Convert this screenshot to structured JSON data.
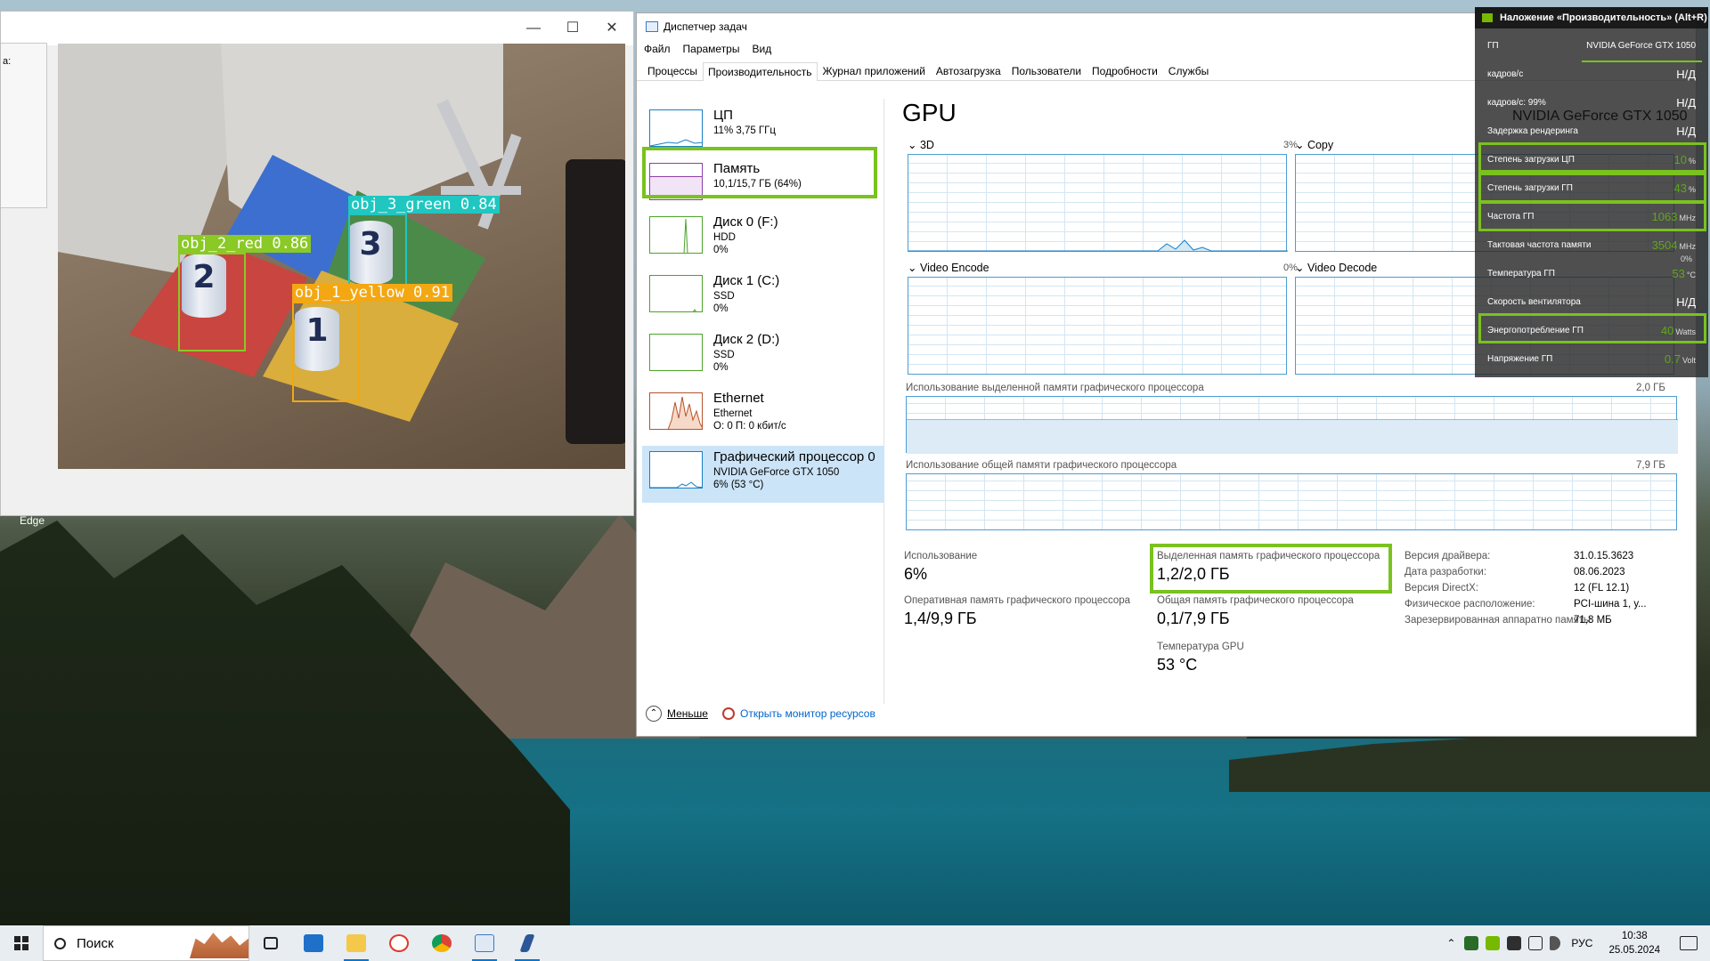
{
  "camera": {
    "left_label": "а:",
    "detections": [
      {
        "label": "obj_3_green 0.84",
        "color": "#1fc7c0",
        "number": "3"
      },
      {
        "label": "obj_2_red 0.86",
        "color": "#8ac926",
        "number": "2"
      },
      {
        "label": "obj_1_yellow 0.91",
        "color": "#f3a712",
        "number": "1"
      }
    ]
  },
  "desktop": {
    "edge_label": "Edge"
  },
  "task_manager": {
    "title": "Диспетчер задач",
    "menu": [
      "Файл",
      "Параметры",
      "Вид"
    ],
    "tabs": [
      "Процессы",
      "Производительность",
      "Журнал приложений",
      "Автозагрузка",
      "Пользователи",
      "Подробности",
      "Службы"
    ],
    "resources": [
      {
        "name": "ЦП",
        "sub1": "11% 3,75 ГГц",
        "sub2": "",
        "color": "#1a7fc4"
      },
      {
        "name": "Память",
        "sub1": "10,1/15,7 ГБ (64%)",
        "sub2": "",
        "color": "#8b3fa8"
      },
      {
        "name": "Диск 0 (F:)",
        "sub1": "HDD",
        "sub2": "0%",
        "color": "#4ca32a"
      },
      {
        "name": "Диск 1 (C:)",
        "sub1": "SSD",
        "sub2": "0%",
        "color": "#4ca32a"
      },
      {
        "name": "Диск 2 (D:)",
        "sub1": "SSD",
        "sub2": "0%",
        "color": "#4ca32a"
      },
      {
        "name": "Ethernet",
        "sub1": "Ethernet",
        "sub2": "О: 0 П: 0 кбит/с",
        "color": "#b5542a"
      },
      {
        "name": "Графический процессор 0",
        "sub1": "NVIDIA GeForce GTX 1050",
        "sub2": "6% (53 °C)",
        "color": "#1a7fc4"
      }
    ],
    "gpu": {
      "title": "GPU",
      "graphs": [
        {
          "label": "3D",
          "pct": "3%"
        },
        {
          "label": "Copy",
          "pct": ""
        },
        {
          "label": "Video Encode",
          "pct": "0%"
        },
        {
          "label": "Video Decode",
          "pct": ""
        }
      ],
      "dedicated_label": "Использование выделенной памяти графического процессора",
      "dedicated_max": "2,0 ГБ",
      "shared_label": "Использование общей памяти графического процессора",
      "shared_max": "7,9 ГБ",
      "stats": {
        "usage_label": "Использование",
        "usage_value": "6%",
        "dedicated_mem_label": "Выделенная память графического процессора",
        "dedicated_mem_value": "1,2/2,0 ГБ",
        "gpu_ram_label": "Оперативная память графического процессора",
        "gpu_ram_value": "1,4/9,9 ГБ",
        "shared_mem_label": "Общая память графического процессора",
        "shared_mem_value": "0,1/7,9 ГБ",
        "temp_label": "Температура GPU",
        "temp_value": "53 °C"
      },
      "info": [
        {
          "key": "Версия драйвера:",
          "value": "31.0.15.3623"
        },
        {
          "key": "Дата разработки:",
          "value": "08.06.2023"
        },
        {
          "key": "Версия DirectX:",
          "value": "12 (FL 12.1)"
        },
        {
          "key": "Физическое расположение:",
          "value": "PCI-шина 1, у..."
        },
        {
          "key": "Зарезервированная аппаратно память:",
          "value": "71,8 МБ"
        }
      ]
    },
    "footer": {
      "less": "Меньше",
      "monitor": "Открыть монитор ресурсов"
    }
  },
  "overlay": {
    "title": "Наложение «Производительность» (Alt+R)",
    "gpu_name_big": "NVIDIA GeForce GTX 1050",
    "rows": [
      {
        "key": "ГП",
        "value": "NVIDIA GeForce GTX 1050",
        "unit": ""
      },
      {
        "key": "кадров/с",
        "value": "Н/Д",
        "unit": ""
      },
      {
        "key": "кадров/с: 99%",
        "value": "Н/Д",
        "unit": ""
      },
      {
        "key": "Задержка рендеринга",
        "value": "Н/Д",
        "unit": ""
      },
      {
        "key": "Степень загрузки ЦП",
        "value": "10",
        "unit": "%"
      },
      {
        "key": "Степень загрузки ГП",
        "value": "43",
        "unit": "%"
      },
      {
        "key": "Частота ГП",
        "value": "1063",
        "unit": "MHz"
      },
      {
        "key": "Тактовая частота памяти",
        "value": "3504",
        "unit": "MHz"
      },
      {
        "key": "Температура ГП",
        "value": "53",
        "unit": "°C"
      },
      {
        "key": "Скорость вентилятора",
        "value": "Н/Д",
        "unit": ""
      },
      {
        "key": "Энергопотребление ГП",
        "value": "40",
        "unit": "Watts"
      },
      {
        "key": "Напряжение ГП",
        "value": "0.7",
        "unit": "Volt"
      }
    ],
    "extra_pct": "0%"
  },
  "taskbar": {
    "search_label": "Поиск",
    "lang": "РУС",
    "time": "10:38",
    "date": "25.05.2024"
  }
}
